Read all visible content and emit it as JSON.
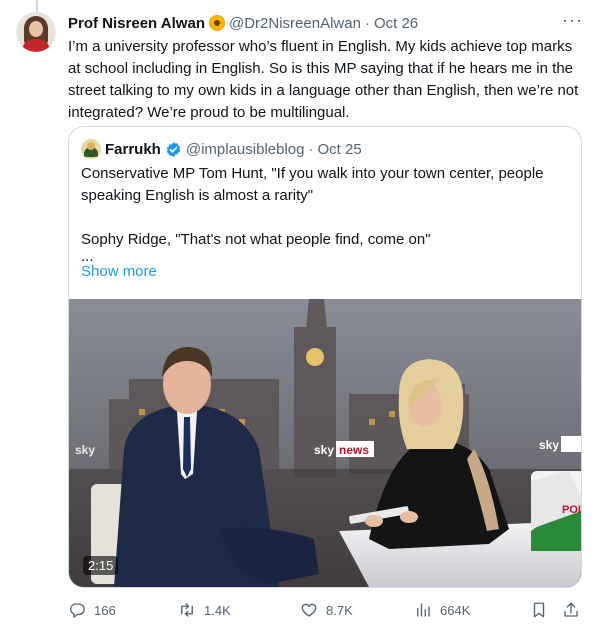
{
  "tweet": {
    "author_name": "Prof Nisreen Alwan",
    "author_emoji": "sunflower-icon",
    "handle": "@Dr2NisreenAlwan",
    "separator": "·",
    "date": "Oct 26",
    "more_icon": "···",
    "text": "I’m a university professor who’s fluent in English. My kids achieve top marks at school including in English. So is this MP saying that if he hears me in the street talking to my own kids in a language other than English, then we’re not integrated? We’re proud to be multilingual."
  },
  "quote": {
    "author_name": "Farrukh",
    "handle": "@implausibleblog",
    "separator": "·",
    "date": "Oct 25",
    "lines": [
      "Conservative MP Tom Hunt, \"If you walk into your town center, people speaking English is almost a rarity\"",
      "",
      "Sophy Ridge, \"That's not what people find, come on\"",
      "..."
    ],
    "show_more": "Show more",
    "video": {
      "duration": "2:15",
      "logo_left": "sky",
      "logo_center_brand": "sky",
      "logo_center_word": "news",
      "logo_right": "sky ne",
      "banner_text": "POL"
    }
  },
  "actions": {
    "replies": "166",
    "reposts": "1.4K",
    "likes": "8.7K",
    "views": "664K"
  },
  "colors": {
    "accent": "#1d9bf0",
    "text": "#0f1419",
    "muted": "#536471",
    "border": "#cfd9de",
    "sky_red": "#c8102e"
  }
}
